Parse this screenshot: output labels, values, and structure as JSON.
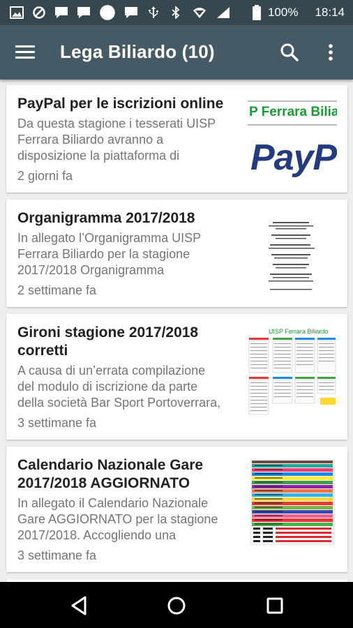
{
  "status_bar": {
    "battery": "100%",
    "time": "18:14",
    "icons": [
      "image-icon",
      "blocked-icon",
      "message-icon",
      "message-icon",
      "circle-icon",
      "message-icon",
      "usb-icon",
      "bluetooth-icon",
      "wifi-icon",
      "signal-icon",
      "battery-icon"
    ]
  },
  "app_bar": {
    "title": "Lega Biliardo (10)",
    "icons": [
      "menu-icon",
      "search-icon",
      "more-vert-icon"
    ]
  },
  "articles": [
    {
      "title": "PayPal per le iscrizioni online",
      "excerpt": "Da questa stagione i tesserati UISP\nFerrara Biliardo avranno a\ndisposizione la piattaforma di",
      "date": "2 giorni fa",
      "thumb_text_1": "P Ferrara Bilia",
      "thumb_text_2": "PayP"
    },
    {
      "title": "Organigramma 2017/2018",
      "excerpt": "In allegato l’Organigramma UISP\nFerrara Biliardo per la stagione\n2017/2018 Organigramma",
      "date": "2 settimane fa"
    },
    {
      "title": "Gironi stagione 2017/2018\ncorretti",
      "excerpt": "A causa di un’errata compilazione\ndel modulo di iscrizione da parte\ndella società Bar Sport Portoverrara,",
      "date": "3 settimane fa",
      "thumb_text_1": "UISP Ferrara Biliardo"
    },
    {
      "title": "Calendario Nazionale Gare\n2017/2018 AGGIORNATO",
      "excerpt": "In allegato il Calendario Nazionale\nGare AGGIORNATO per la stagione\n2017/2018. Accogliendo una",
      "date": "3 settimane fa"
    }
  ],
  "nav_bar": {
    "icons": [
      "back-icon",
      "home-icon",
      "recents-icon"
    ]
  },
  "colors": {
    "status_bar": "#37474f",
    "app_bar": "#455a64",
    "paypal_dark": "#253b80",
    "paypal_light": "#179bd7",
    "thumb_green": "#1a9b35"
  }
}
